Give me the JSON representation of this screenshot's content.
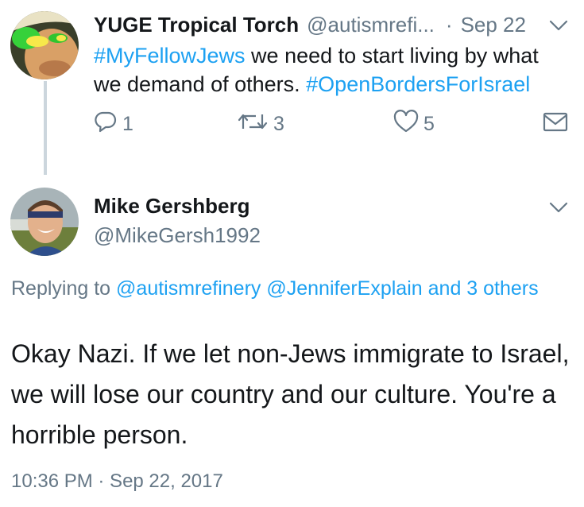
{
  "tweet1": {
    "display_name": "YUGE Tropical Torch",
    "handle": "@autismrefi...",
    "separator": "·",
    "date": "Sep 22",
    "text": {
      "hashtag1": "#MyFellowJews",
      "part1": " we need to start living by what we demand of others. ",
      "hashtag2": "#OpenBordersForIsrael"
    },
    "reply_count": "1",
    "retweet_count": "3",
    "like_count": "5"
  },
  "tweet2": {
    "display_name": "Mike Gershberg",
    "handle": "@MikeGersh1992",
    "replying": {
      "prefix": "Replying to ",
      "mention1": "@autismrefinery",
      "space": " ",
      "mention2": "@JenniferExplain",
      "and_others": " and 3 others"
    },
    "text": "Okay Nazi. If we let non-Jews immigrate to Israel, we will lose our country and our culture. You're a horrible person.",
    "timestamp": "10:36 PM · Sep 22, 2017"
  },
  "icons": {
    "reply": "reply-icon",
    "retweet": "retweet-icon",
    "like": "heart-icon",
    "dm": "envelope-icon",
    "menu": "chevron-down-icon"
  },
  "colors": {
    "link": "#1da1f2",
    "secondary_text": "#657786",
    "primary_text": "#14171a",
    "thread_line": "#ccd6dd"
  }
}
